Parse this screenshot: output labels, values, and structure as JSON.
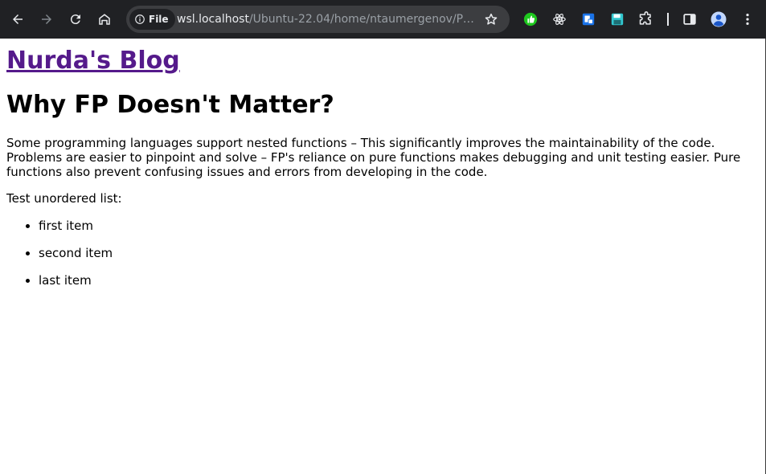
{
  "browser": {
    "site_chip_label": "File",
    "url_host": "wsl.localhost",
    "url_path": "/Ubuntu-22.04/home/ntaumergenov/Projects...",
    "colors": {
      "toolbar": "#202124",
      "omnibox": "#3c3d40",
      "ext_green": "#1ec81e",
      "ext_blue": "#1a73e8",
      "ext_teal": "#32c8d0"
    },
    "icons": [
      "back-icon",
      "forward-icon",
      "reload-icon",
      "home-icon",
      "info-icon",
      "star-icon",
      "extension-thumb-icon",
      "react-devtools-icon",
      "extension-page-icon",
      "save-icon",
      "extensions-puzzle-icon",
      "side-panel-icon",
      "profile-icon",
      "menu-kebab-icon"
    ]
  },
  "page": {
    "blog_title": "Nurda's Blog",
    "post_title": "Why FP Doesn't Matter?",
    "post_body": "Some programming languages support nested functions – This significantly improves the maintainability of the code. Problems are easier to pinpoint and solve – FP's reliance on pure functions makes debugging and unit testing easier. Pure functions also prevent confusing issues and errors from developing in the code.",
    "list_intro": "Test unordered list:",
    "list_items": [
      "first item",
      "second item",
      "last item"
    ],
    "link_color": "#551a8b"
  }
}
